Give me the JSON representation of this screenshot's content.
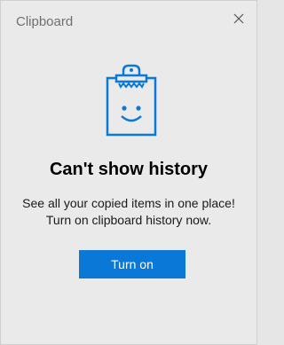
{
  "window": {
    "title": "Clipboard",
    "close_icon": "close-icon"
  },
  "empty_state": {
    "illustration_icon": "clipboard-smiley-icon",
    "heading": "Can't show history",
    "description_line1": "See all your copied items in one place!",
    "description_line2": "Turn on clipboard history now.",
    "button_label": "Turn on"
  },
  "colors": {
    "accent": "#0a78d7",
    "background": "#eaeaea"
  }
}
